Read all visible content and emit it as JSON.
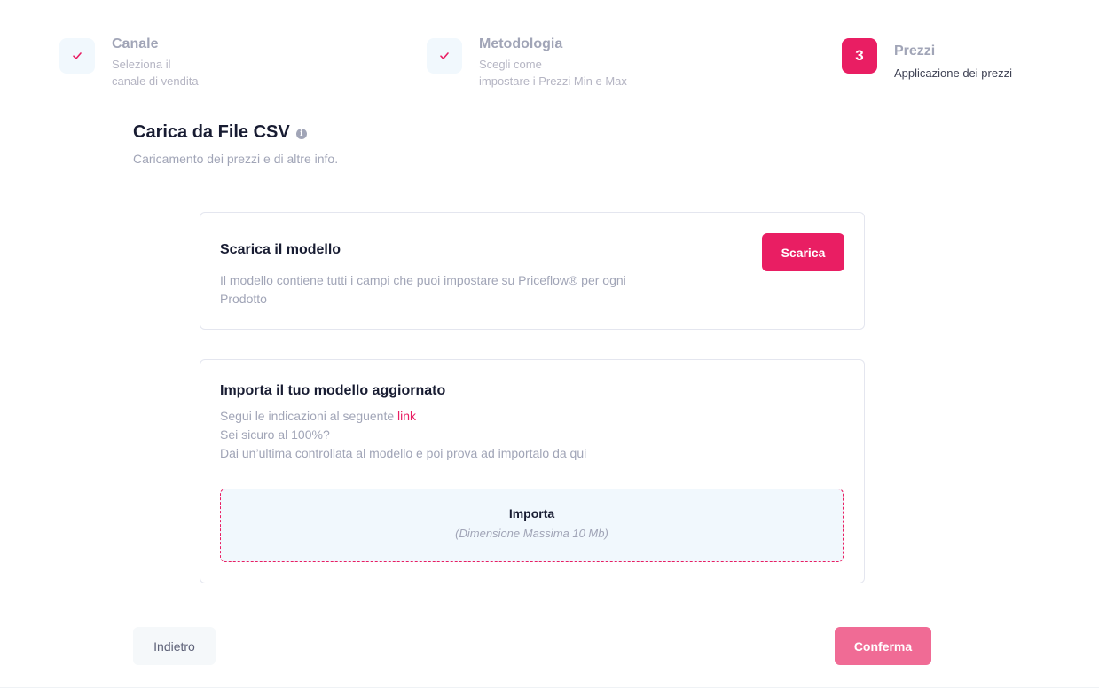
{
  "colors": {
    "accent": "#e91e63",
    "accent_disabled": "#f06b95",
    "muted_text": "#a1a5b7",
    "dark_text": "#181c32",
    "light_bg": "#f1f8fd"
  },
  "stepper": {
    "steps": [
      {
        "state": "completed",
        "icon": "check-icon",
        "title": "Canale",
        "desc_line1": "Seleziona il",
        "desc_line2": "canale di vendita"
      },
      {
        "state": "completed",
        "icon": "check-icon",
        "title": "Metodologia",
        "desc_line1": "Scegli come",
        "desc_line2": "impostare i Prezzi Min e Max"
      },
      {
        "state": "current",
        "number": "3",
        "title": "Prezzi",
        "desc_line1": "Applicazione dei prezzi"
      }
    ]
  },
  "header": {
    "title": "Carica da File CSV",
    "info_icon": "i",
    "subtitle": "Caricamento dei prezzi e di altre info."
  },
  "download_card": {
    "title": "Scarica il modello",
    "description": "Il modello contiene tutti i campi che puoi impostare su Priceflow® per ogni Prodotto",
    "button_label": "Scarica"
  },
  "import_card": {
    "title": "Importa il tuo modello aggiornato",
    "line1_prefix": "Segui le indicazioni al seguente ",
    "line1_link": "link",
    "line2": "Sei sicuro al 100%?",
    "line3": "Dai un’ultima controllata al modello e poi prova ad importalo da qui",
    "dropzone_title": "Importa",
    "dropzone_hint": "(Dimensione Massima 10 Mb)"
  },
  "footer": {
    "back_label": "Indietro",
    "confirm_label": "Conferma"
  }
}
